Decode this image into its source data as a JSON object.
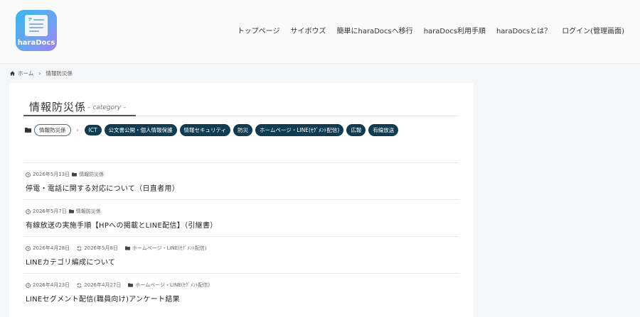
{
  "site": {
    "logo_text": "haraDocs"
  },
  "nav": {
    "items": [
      {
        "label": "トップページ"
      },
      {
        "label": "サイボウズ"
      },
      {
        "label": "簡単にharaDocsへ移行"
      },
      {
        "label": "haraDocs利用手順"
      },
      {
        "label": "haraDocsとは？"
      },
      {
        "label": "ログイン(管理画面)"
      }
    ]
  },
  "breadcrumb": {
    "home": "ホーム",
    "current": "情報防災係"
  },
  "category": {
    "title": "情報防災係",
    "subtitle": "– category –",
    "current_tag": "情報防災係",
    "tags": [
      {
        "label": "ICT"
      },
      {
        "label": "公文書公開・個人情報保護"
      },
      {
        "label": "情報セキュリティ"
      },
      {
        "label": "防災"
      },
      {
        "label": "ホームページ・LINE(ｾｸﾞﾒﾝﾄ配信)"
      },
      {
        "label": "広報"
      },
      {
        "label": "有線放送"
      }
    ]
  },
  "posts": [
    {
      "date": "2026年5月13日",
      "updated": "",
      "category": "情報防災係",
      "title": "停電・電話に関する対応について（日直者用）"
    },
    {
      "date": "2026年5月7日",
      "updated": "",
      "category": "情報防災係",
      "title": "有線放送の実施手順【HPへの掲載とLINE配信】（引継書）"
    },
    {
      "date": "2026年4月28日",
      "updated": "2026年5月8日",
      "category": "ホームページ・LINE(ｾｸﾞﾒﾝﾄ配信)",
      "title": "LINEカテゴリ編成について"
    },
    {
      "date": "2026年4月23日",
      "updated": "2026年4月27日",
      "category": "ホームページ・LINE(ｾｸﾞﾒﾝﾄ配信)",
      "title": "LINEセグメント配信(職員向け)アンケート結果"
    }
  ]
}
